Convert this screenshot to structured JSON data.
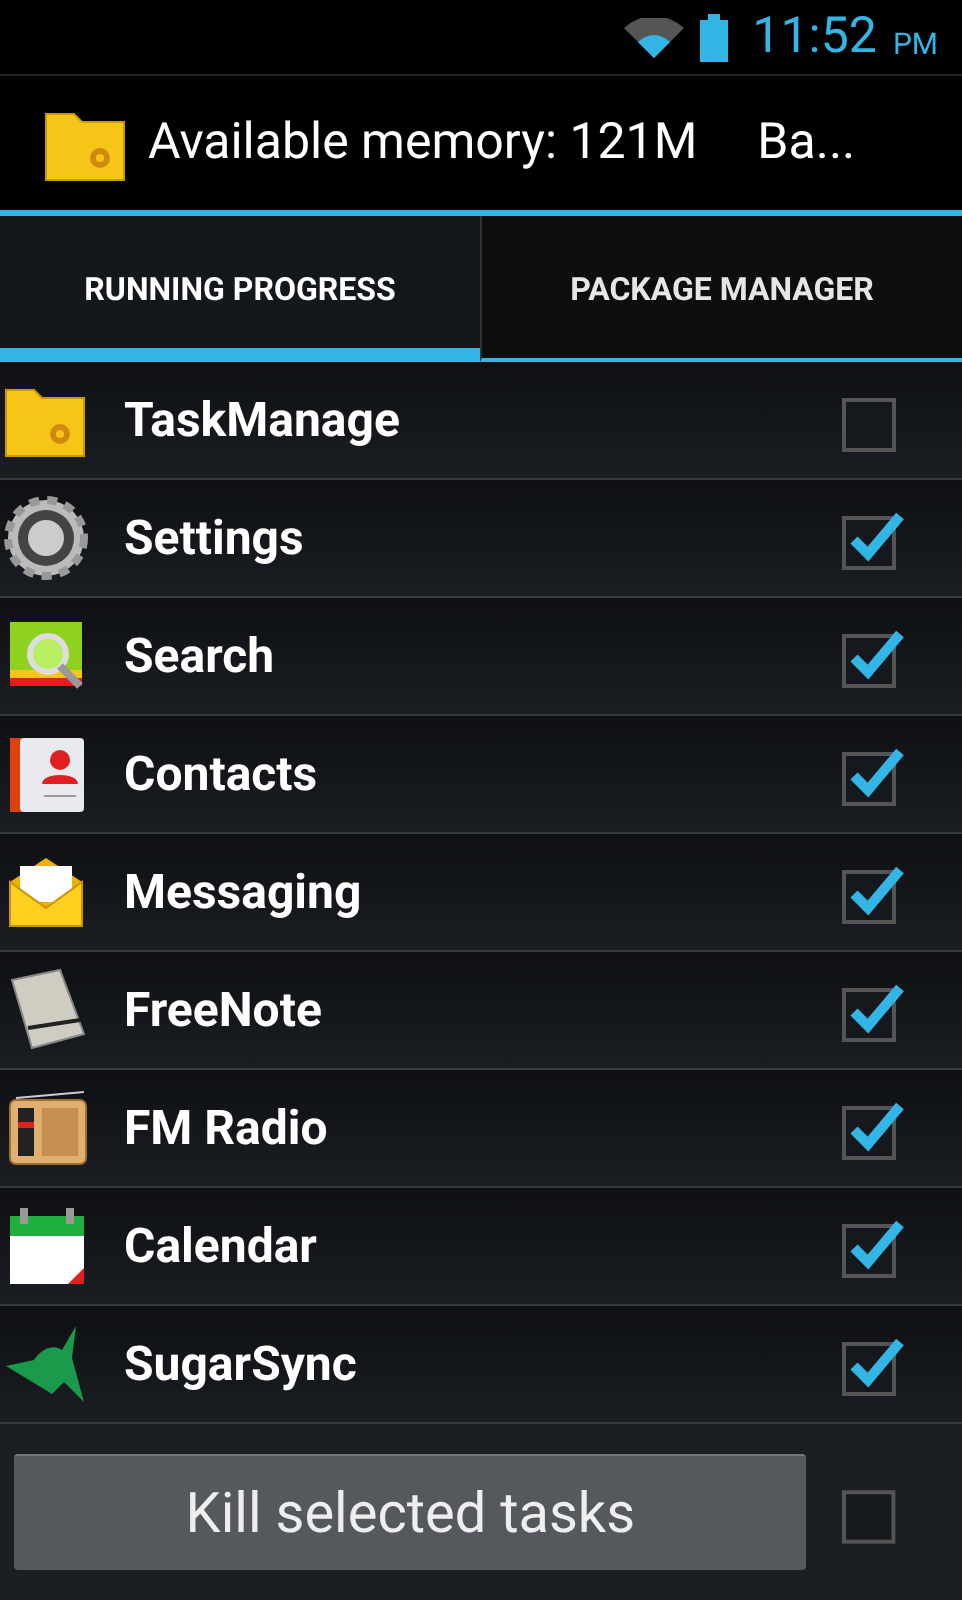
{
  "status_bar": {
    "time": "11:52",
    "ampm": "PM"
  },
  "header": {
    "title": "Available memory: 121M",
    "extra": "Ba..."
  },
  "tabs": [
    {
      "label": "RUNNING PROGRESS",
      "selected": true
    },
    {
      "label": "PACKAGE MANAGER",
      "selected": false
    }
  ],
  "apps": [
    {
      "name": "TaskManage",
      "checked": false
    },
    {
      "name": "Settings",
      "checked": true
    },
    {
      "name": "Search",
      "checked": true
    },
    {
      "name": "Contacts",
      "checked": true
    },
    {
      "name": "Messaging",
      "checked": true
    },
    {
      "name": "FreeNote",
      "checked": true
    },
    {
      "name": "FM Radio",
      "checked": true
    },
    {
      "name": "Calendar",
      "checked": true
    },
    {
      "name": "SugarSync",
      "checked": true
    }
  ],
  "footer": {
    "button": "Kill selected tasks",
    "select_all": {
      "checked": false
    }
  }
}
